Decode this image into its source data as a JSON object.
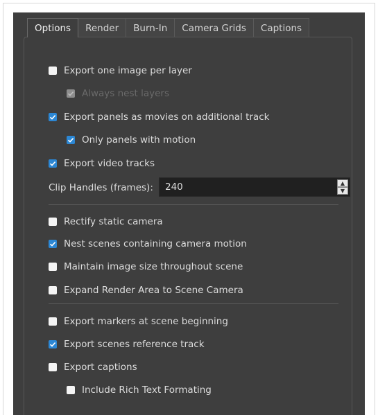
{
  "tabs": [
    {
      "label": "Options",
      "active": true
    },
    {
      "label": "Render",
      "active": false
    },
    {
      "label": "Burn-In",
      "active": false
    },
    {
      "label": "Camera Grids",
      "active": false
    },
    {
      "label": "Captions",
      "active": false
    }
  ],
  "options": {
    "export_one_image_per_layer": {
      "label": "Export one image per layer",
      "checked": false
    },
    "always_nest_layers": {
      "label": "Always nest layers",
      "checked": true,
      "disabled": true
    },
    "export_panels_as_movies": {
      "label": "Export panels as movies on additional track",
      "checked": true
    },
    "only_panels_with_motion": {
      "label": "Only panels with motion",
      "checked": true
    },
    "export_video_tracks": {
      "label": "Export video tracks",
      "checked": true
    },
    "clip_handles": {
      "label": "Clip Handles (frames):",
      "value": "240"
    },
    "rectify_static_camera": {
      "label": "Rectify static camera",
      "checked": false
    },
    "nest_scenes_camera_motion": {
      "label": "Nest scenes containing camera motion",
      "checked": true
    },
    "maintain_image_size": {
      "label": "Maintain image size throughout scene",
      "checked": false
    },
    "expand_render_area": {
      "label": "Expand Render Area to Scene Camera",
      "checked": false
    },
    "export_markers": {
      "label": "Export markers at scene beginning",
      "checked": false
    },
    "export_scenes_reference": {
      "label": "Export scenes reference track",
      "checked": true
    },
    "export_captions": {
      "label": "Export captions",
      "checked": false
    },
    "include_rich_text": {
      "label": "Include Rich Text Formating",
      "checked": false
    }
  },
  "colors": {
    "panel_bg": "#3e3e3e",
    "accent": "#2c87d4",
    "field_bg": "#202020"
  },
  "icons": {
    "check": "checkmark-icon",
    "spin_up": "arrow-up-icon",
    "spin_down": "arrow-down-icon"
  }
}
